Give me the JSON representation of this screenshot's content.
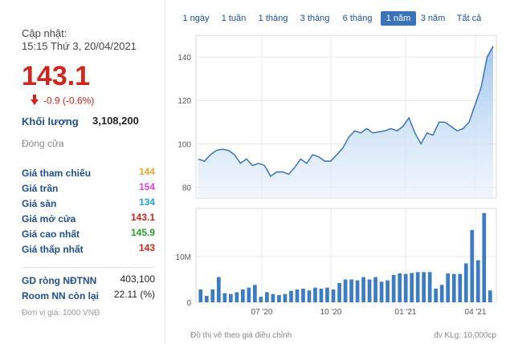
{
  "header": {
    "update_label": "Cập nhật:",
    "update_time": "15:15 Thứ 3, 20/04/2021"
  },
  "quote": {
    "price": "143.1",
    "change": "-0.9 (-0.6%)",
    "volume_label": "Khối lượng",
    "volume_value": "3,108,200",
    "close_label": "Đóng cửa"
  },
  "stats": [
    {
      "label": "Giá tham chiếu",
      "value": "144",
      "color": "#f0a02c"
    },
    {
      "label": "Giá trần",
      "value": "154",
      "color": "#e040d8"
    },
    {
      "label": "Giá sàn",
      "value": "134",
      "color": "#1ba8d8"
    },
    {
      "label": "Giá mở cửa",
      "value": "143.1",
      "color": "#d0251d"
    },
    {
      "label": "Giá cao nhất",
      "value": "145.9",
      "color": "#28a028"
    },
    {
      "label": "Giá thấp nhất",
      "value": "143",
      "color": "#d0251d"
    }
  ],
  "foreign": [
    {
      "label": "GD ròng NĐTNN",
      "value": "403,100"
    },
    {
      "label": "Room NN còn lại",
      "value": "22.11 (%)"
    }
  ],
  "unit_note": "Đơn vị giá: 1000 VNĐ",
  "tabs": [
    {
      "label": "1 ngày",
      "active": false
    },
    {
      "label": "1 tuần",
      "active": false
    },
    {
      "label": "1 tháng",
      "active": false
    },
    {
      "label": "3 tháng",
      "active": false
    },
    {
      "label": "6 tháng",
      "active": false
    },
    {
      "label": "1 năm",
      "active": true
    },
    {
      "label": "3 năm",
      "active": false
    },
    {
      "label": "Tất cả",
      "active": false
    }
  ],
  "chart_data": {
    "type": "area",
    "price_axis": {
      "ticks": [
        80,
        100,
        120,
        140
      ],
      "ylim": [
        75,
        150
      ]
    },
    "volume_axis": {
      "ticks": [
        "0",
        "10M"
      ],
      "tick_values": [
        0,
        10
      ],
      "ylim": [
        0,
        20.5
      ]
    },
    "x_ticks": [
      "07 '20",
      "10 '20",
      "01 '21",
      "04 '21"
    ],
    "price": [
      93,
      92,
      95,
      97,
      97.5,
      97,
      95,
      91,
      93,
      90,
      91,
      90,
      85,
      87,
      87,
      86,
      89,
      93,
      91,
      95,
      94,
      92,
      92,
      95,
      98,
      103,
      106,
      105,
      107,
      105,
      105.5,
      106,
      107,
      106,
      108,
      112,
      105,
      100,
      105,
      104,
      110,
      110,
      108,
      106,
      107,
      110,
      118,
      126,
      140,
      145
    ],
    "volume": [
      2.8,
      1.4,
      2.8,
      5.5,
      2.0,
      1.8,
      2.2,
      2.8,
      3.2,
      3.8,
      1.2,
      2.2,
      1.8,
      1.6,
      1.8,
      2.5,
      2.8,
      3.0,
      2.6,
      3.2,
      3.0,
      3.2,
      2.8,
      4.2,
      5.0,
      5.0,
      4.8,
      5.5,
      5.0,
      5.5,
      4.5,
      4.8,
      6.0,
      6.3,
      6.2,
      6.4,
      6.6,
      6.6,
      6.6,
      3.0,
      3.8,
      6.3,
      6.2,
      6.2,
      8.5,
      15.8,
      9.2,
      19.5,
      2.6
    ],
    "volume_unit": "10,000cp",
    "footnote_left": "Đồ thị vẽ theo giá điều chỉnh",
    "footnote_right": "đv KLg: 10,000cp"
  }
}
